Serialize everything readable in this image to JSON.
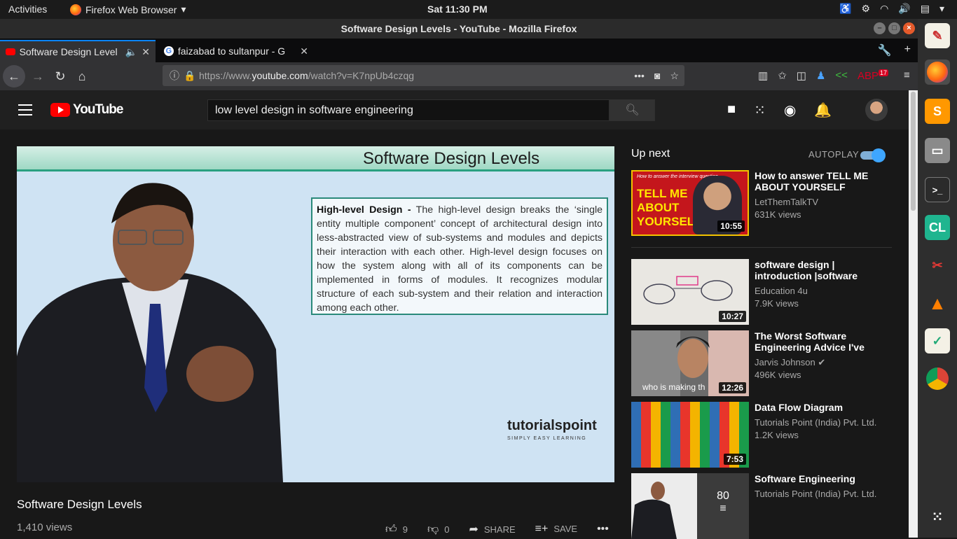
{
  "topbar": {
    "activities": "Activities",
    "app_menu": "Firefox Web Browser",
    "clock": "Sat 11:30 PM"
  },
  "window": {
    "title": "Software Design Levels - YouTube - Mozilla Firefox"
  },
  "tabs": [
    {
      "label": "Software Design Level",
      "active": true,
      "favicon": "youtube-icon"
    },
    {
      "label": "faizabad to sultanpur - G",
      "active": false,
      "favicon": "google-icon"
    }
  ],
  "navbar": {
    "url_prefix": "https://www.",
    "url_domain": "youtube.com",
    "url_path": "/watch?v=K7npUb4czqg",
    "addon_badge": "17"
  },
  "youtube": {
    "logo_text": "YouTube",
    "search_value": "low level design in software engineering"
  },
  "video": {
    "slide_title": "Software Design Levels",
    "slide_heading": "High-level Design -",
    "slide_text": " The high-level design breaks the ‘single entity multiple component’ concept of architectural design into less-abstracted view of sub-systems and modules and depicts their interaction with each other. High-level design focuses on how the system along with all of its components can be implemented in forms of modules. It recognizes modular structure of each sub-system and their relation and interaction among each other.",
    "brand": "tutorialspoint",
    "brand_sub": "SIMPLY EASY LEARNING",
    "title": "Software Design Levels",
    "views": "1,410 views",
    "likes": "9",
    "dislikes": "0",
    "share": "SHARE",
    "save": "SAVE"
  },
  "sidebar": {
    "up_next": "Up next",
    "autoplay": "AUTOPLAY",
    "autoplay_on": true,
    "recommendations": [
      {
        "title": "How to answer TELL ME ABOUT YOURSELF",
        "channel": "LetThemTalkTV",
        "views": "631K views",
        "duration": "10:55",
        "thumb_text": "TELL ME ABOUT YOURSELF",
        "thumb_caption": "How to answer the interview question"
      },
      {
        "title": "software design | introduction |software",
        "channel": "Education 4u",
        "views": "7.9K views",
        "duration": "10:27"
      },
      {
        "title": "The Worst Software Engineering Advice I've",
        "channel": "Jarvis Johnson",
        "views": "496K views",
        "duration": "12:26",
        "thumb_caption": "who is making th"
      },
      {
        "title": "Data Flow Diagram",
        "channel": "Tutorials Point (India) Pvt. Ltd.",
        "views": "1.2K views",
        "duration": "7:53"
      },
      {
        "title": "Software Engineering",
        "channel": "Tutorials Point (India) Pvt. Ltd.",
        "views": "",
        "duration": "",
        "playlist_count": "80"
      }
    ]
  },
  "colors": {
    "yt_red": "#ff0000",
    "accent_blue": "#3ea6ff",
    "firefox_tab_accent": "#0a84ff"
  }
}
